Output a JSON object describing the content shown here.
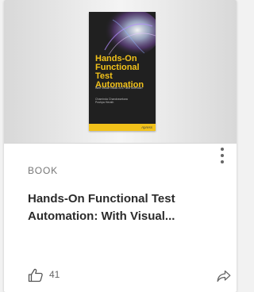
{
  "card": {
    "type_label": "BOOK",
    "title": "Hands-On Functional Test Automation: With Visual...",
    "likes": "41",
    "icons": {
      "menu": "more-vertical-icon",
      "like": "thumbs-up-icon",
      "share": "share-arrow-icon"
    }
  },
  "cover": {
    "title": "Hands-On Functional Test Automation",
    "subtitle": "With Visual Studio 2017 and Selenium",
    "authors": "Chaminda Chandrasekara\nPushpa Herath",
    "publisher": "Apress",
    "accent_color": "#f2c21a",
    "background_color": "#202020"
  }
}
